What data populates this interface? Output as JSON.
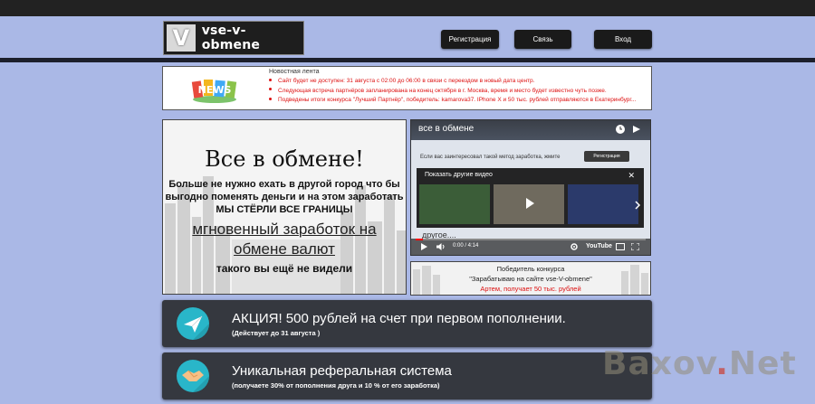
{
  "header": {
    "logo_letter": "V",
    "logo_text": "vse-v-obmene",
    "nav": [
      {
        "label": "Регистрация"
      },
      {
        "label": "Связь"
      },
      {
        "label": "Вход"
      }
    ]
  },
  "news": {
    "logo_text": "NEWS",
    "title": "Новостная лента",
    "items": [
      "Сайт будет не доступен: 31 августа с 02:00 до 06:00 в связи с переездом в новый дата центр.",
      "Следующая встреча партнёров запланирована на конец октября в г. Москва, время и место будет известно чуть позже.",
      "Подведены итоги конкурса \"Лучший Партнёр\", победитель: kamarova37. IPhone X и 50 тыс. рублей отправляются в Екатеринбург..."
    ]
  },
  "promo": {
    "title": "Все в обмене!",
    "subtitle_lines": [
      "Больше не нужно ехать в другой город что бы",
      "выгодно поменять деньги и на этом заработать",
      "МЫ СТЁРЛИ ВСЕ ГРАНИЦЫ"
    ],
    "link_lines": [
      "мгновенный  заработок на",
      "обмене валют"
    ],
    "footer": "такого вы ещё не видели"
  },
  "video": {
    "title": "все в обмене",
    "caption": "Если вас заинтересовал такой метод заработка, жмите",
    "register_label": "Регистрация",
    "overlay_title": "Показать другие видео",
    "more_text": "другое....",
    "time": "0:00 / 4:14",
    "brand": "YouTube",
    "progress": 0.03
  },
  "winner": {
    "line1": "Победитель конкурса",
    "line2": "\"Зарабатываю на сайте vse-V-obmene\"",
    "line3": "Артем, получает 50 тыс. рублей"
  },
  "banners": [
    {
      "title": "АКЦИЯ! 500 рублей на счет при первом пополнении.",
      "note": "(Действует  до 31 августа )",
      "icon": "paper-plane-icon"
    },
    {
      "title": "Уникальная реферальная система",
      "note": "(получаете 30% от пополнения друга и 10 % от его заработка)",
      "icon": "handshake-icon"
    }
  ],
  "watermark": {
    "text_a": "Baxov",
    "dot": ".",
    "text_b": "Net"
  },
  "colors": {
    "page_bg": "#aab8e6",
    "topbar": "#222222",
    "news_red": "#dd1111",
    "banner_bg": "#35383f",
    "icon_teal": "#29b6c9"
  }
}
